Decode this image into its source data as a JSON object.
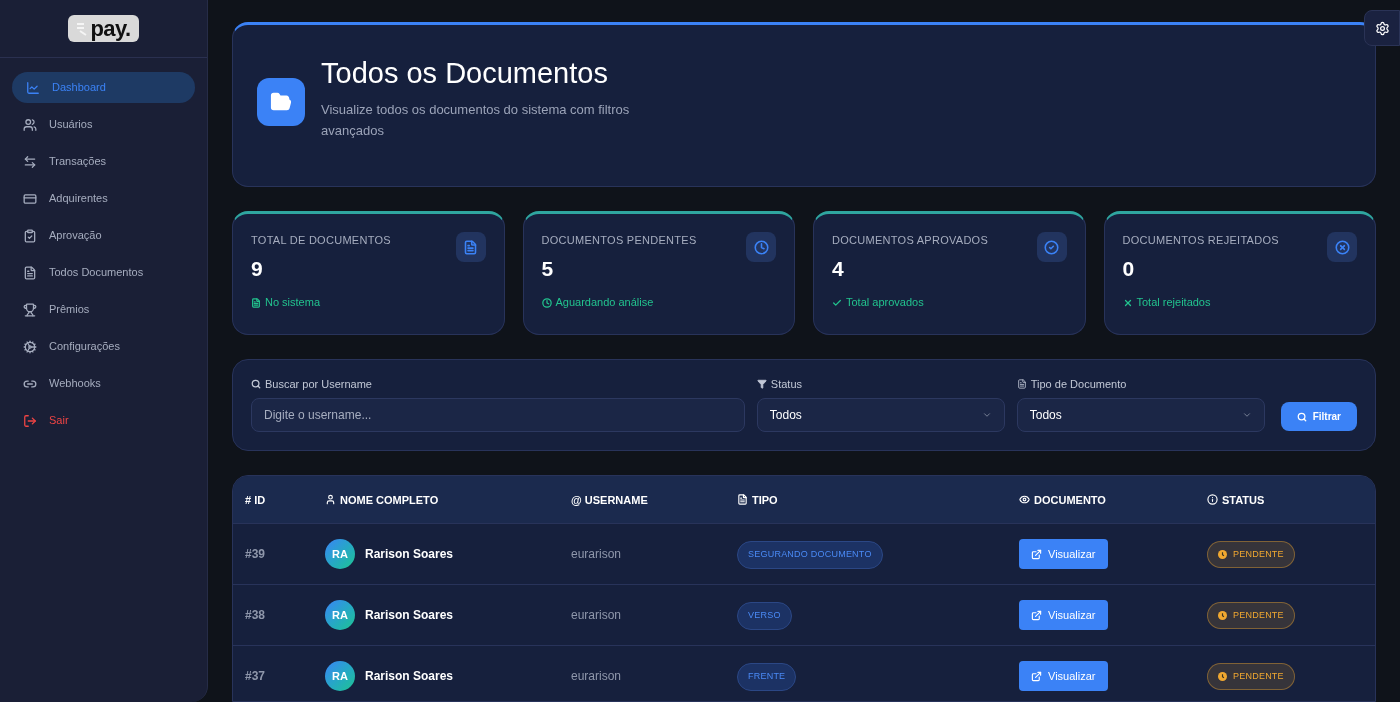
{
  "sidebar": {
    "logo": "pay.",
    "items": [
      {
        "label": "Dashboard",
        "selected": true,
        "kind": "nav"
      },
      {
        "label": "Usuários",
        "selected": false,
        "kind": "nav"
      },
      {
        "label": "Transações",
        "selected": false,
        "kind": "nav"
      },
      {
        "label": "Adquirentes",
        "selected": false,
        "kind": "nav"
      },
      {
        "label": "Aprovação",
        "selected": false,
        "kind": "nav"
      },
      {
        "label": "Todos Documentos",
        "selected": false,
        "kind": "nav"
      },
      {
        "label": "Prêmios",
        "selected": false,
        "kind": "nav"
      },
      {
        "label": "Configurações",
        "selected": false,
        "kind": "nav"
      },
      {
        "label": "Webhooks",
        "selected": false,
        "kind": "nav"
      },
      {
        "label": "Sair",
        "selected": false,
        "kind": "logout"
      }
    ]
  },
  "header": {
    "title": "Todos os Documentos",
    "subtitle": "Visualize todos os documentos do sistema com filtros avançados"
  },
  "stats": [
    {
      "label": "TOTAL DE DOCUMENTOS",
      "value": "9",
      "note": "No sistema"
    },
    {
      "label": "DOCUMENTOS PENDENTES",
      "value": "5",
      "note": "Aguardando análise"
    },
    {
      "label": "DOCUMENTOS APROVADOS",
      "value": "4",
      "note": "Total aprovados"
    },
    {
      "label": "DOCUMENTOS REJEITADOS",
      "value": "0",
      "note": "Total rejeitados"
    }
  ],
  "filters": {
    "search": {
      "label": "Buscar por Username",
      "placeholder": "Digite o username..."
    },
    "status": {
      "label": "Status",
      "value": "Todos"
    },
    "type": {
      "label": "Tipo de Documento",
      "value": "Todos"
    },
    "button": "Filtrar"
  },
  "table": {
    "columns": [
      "# ID",
      "NOME COMPLETO",
      "@ USERNAME",
      "TIPO",
      "DOCUMENTO",
      "STATUS"
    ],
    "rows": [
      {
        "id": "#39",
        "initials": "RA",
        "name": "Rarison Soares",
        "username": "eurarison",
        "type": "SEGURANDO DOCUMENTO",
        "action": "Visualizar",
        "status": {
          "label": "PENDENTE",
          "color": "#f0a830"
        }
      },
      {
        "id": "#38",
        "initials": "RA",
        "name": "Rarison Soares",
        "username": "eurarison",
        "type": "VERSO",
        "action": "Visualizar",
        "status": {
          "label": "PENDENTE",
          "color": "#f0a830"
        }
      },
      {
        "id": "#37",
        "initials": "RA",
        "name": "Rarison Soares",
        "username": "eurarison",
        "type": "FRENTE",
        "action": "Visualizar",
        "status": {
          "label": "PENDENTE",
          "color": "#f0a830"
        }
      }
    ]
  }
}
